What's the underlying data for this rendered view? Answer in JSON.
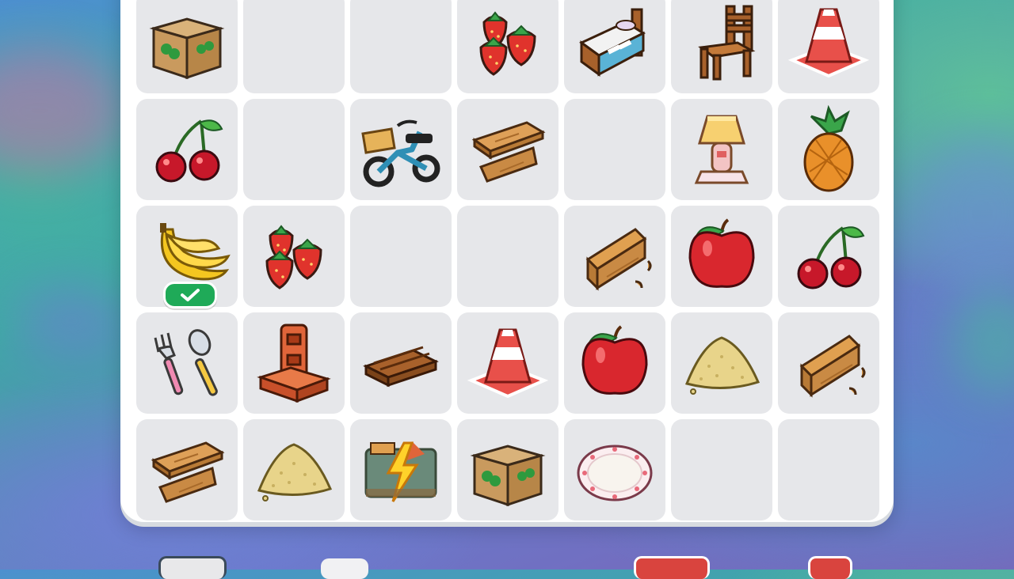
{
  "board": {
    "columns": 7,
    "rows": 5,
    "cells": [
      {
        "item": "cardboard-box-icon"
      },
      {
        "item": "empty"
      },
      {
        "item": "empty"
      },
      {
        "item": "strawberries-icon"
      },
      {
        "item": "bed-icon"
      },
      {
        "item": "wooden-chair-icon"
      },
      {
        "item": "traffic-cone-icon"
      },
      {
        "item": "cherries-icon"
      },
      {
        "item": "empty"
      },
      {
        "item": "bicycle-icon"
      },
      {
        "item": "wooden-planks-icon"
      },
      {
        "item": "empty"
      },
      {
        "item": "table-lamp-icon"
      },
      {
        "item": "pineapple-icon"
      },
      {
        "item": "bananas-icon",
        "completed": true
      },
      {
        "item": "strawberries-icon"
      },
      {
        "item": "empty"
      },
      {
        "item": "empty"
      },
      {
        "item": "wooden-log-icon"
      },
      {
        "item": "apple-icon"
      },
      {
        "item": "cherries-icon"
      },
      {
        "item": "fork-spoon-icon"
      },
      {
        "item": "brick-blocks-icon"
      },
      {
        "item": "wooden-pallet-icon"
      },
      {
        "item": "traffic-cone-icon"
      },
      {
        "item": "apple-icon"
      },
      {
        "item": "sand-pile-icon"
      },
      {
        "item": "wooden-log-icon"
      },
      {
        "item": "wooden-planks-icon"
      },
      {
        "item": "sand-pile-icon"
      },
      {
        "item": "energy-crate-icon"
      },
      {
        "item": "cardboard-box-icon"
      },
      {
        "item": "plate-icon"
      },
      {
        "item": "empty"
      },
      {
        "item": "empty"
      }
    ]
  },
  "colors": {
    "cell_bg": "#e6e7ea",
    "board_bg": "#ffffff",
    "check_badge": "#1faa58"
  }
}
